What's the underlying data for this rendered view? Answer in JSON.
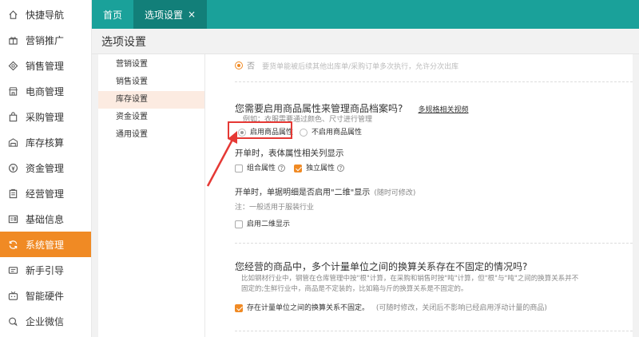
{
  "sidebar": {
    "items": [
      {
        "label": "快捷导航",
        "icon": "home-icon"
      },
      {
        "label": "营销推广",
        "icon": "gift-icon"
      },
      {
        "label": "销售管理",
        "icon": "diamond-icon"
      },
      {
        "label": "电商管理",
        "icon": "shop-icon"
      },
      {
        "label": "采购管理",
        "icon": "bag-icon"
      },
      {
        "label": "库存核算",
        "icon": "warehouse-icon"
      },
      {
        "label": "资金管理",
        "icon": "coin-icon"
      },
      {
        "label": "经营管理",
        "icon": "clipboard-icon"
      },
      {
        "label": "基础信息",
        "icon": "id-card-icon"
      },
      {
        "label": "系统管理",
        "icon": "refresh-icon",
        "active": true
      },
      {
        "label": "新手引导",
        "icon": "guide-icon"
      },
      {
        "label": "智能硬件",
        "icon": "tv-icon"
      },
      {
        "label": "企业微信",
        "icon": "wechat-icon"
      }
    ]
  },
  "tabs": [
    {
      "label": "首页"
    },
    {
      "label": "选项设置",
      "active": true,
      "close": "×"
    }
  ],
  "page_title": "选项设置",
  "submenu": {
    "items": [
      "营销设置",
      "销售设置",
      "库存设置",
      "资金设置",
      "通用设置"
    ],
    "active_index": 2
  },
  "content": {
    "top_option": {
      "label": "否",
      "desc": "要货单能被后续其他出库单/采购订单多次执行，允许分次出库"
    },
    "attr_section": {
      "question": "您需要启用商品属性来管理商品档案吗?",
      "link": "多规格相关视频",
      "example": "例如：衣服需要通过颜色、尺寸进行管理",
      "option_on": "启用商品属性",
      "option_off": "不启用商品属性",
      "list_heading": "开单时，表体属性相关列显示",
      "combo_attr": "组合属性",
      "independent_attr": "独立属性",
      "help_glyph": "?",
      "two_dim_heading": "开单时，单据明细是否启用\"二维\"显示",
      "two_dim_note": "(随时可修改)",
      "two_dim_tip": "注：一般适用于服装行业",
      "enable_two_dim": "启用二维显示"
    },
    "unit_section": {
      "question": "您经营的商品中，多个计量单位之间的换算关系存在不固定的情况吗?",
      "desc_line1": "比如钢材行业中，钢管在仓库管理中按\"根\"计算，在采购和销售时按\"吨\"计算，但\"根\"与\"吨\"之间的换算关系并不",
      "desc_line2": "固定的;生鲜行业中，商品是不定装的，比如箱与斤的换算关系是不固定的。",
      "option": "存在计量单位之间的换算关系不固定。",
      "note": "(可随时修改，关闭后不影响已经启用浮动计量的商品)"
    }
  },
  "colors": {
    "teal": "#1aa19a",
    "orange": "#f08a24",
    "red_highlight": "#e53935"
  }
}
